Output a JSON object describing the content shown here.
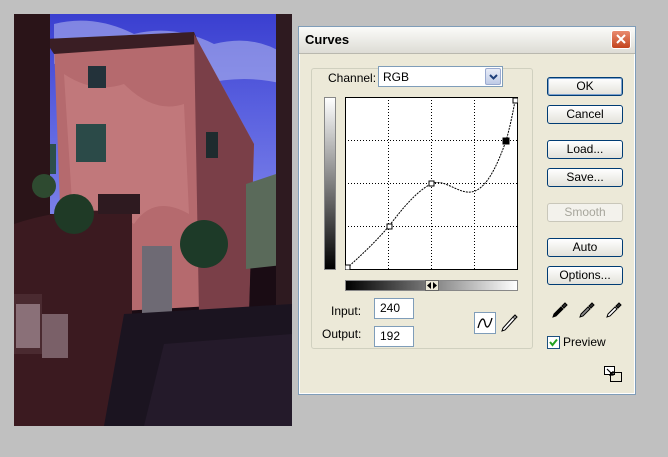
{
  "dialog": {
    "title": "Curves",
    "channel_label": "Channel:",
    "channel_value": "RGB",
    "input_label": "Input:",
    "input_value": "240",
    "output_label": "Output:",
    "output_value": "192",
    "buttons": {
      "ok": "OK",
      "cancel": "Cancel",
      "load": "Load...",
      "save": "Save...",
      "smooth": "Smooth",
      "auto": "Auto",
      "options": "Options..."
    },
    "preview_label": "Preview",
    "preview_checked": true
  },
  "icons": {
    "close": "close-icon",
    "dropdown": "chevron-down-icon",
    "curve_tool": "curve-icon",
    "pencil_tool": "pencil-icon",
    "black_eyedropper": "black-point-eyedropper-icon",
    "gray_eyedropper": "gray-point-eyedropper-icon",
    "white_eyedropper": "white-point-eyedropper-icon",
    "resize": "expand-icon"
  },
  "colors": {
    "title_bar": "#f5f4f0",
    "dialog_bg": "#ece9d8",
    "close_button": "#d6552f",
    "button_border": "#003c74",
    "field_border": "#7f9db9"
  }
}
